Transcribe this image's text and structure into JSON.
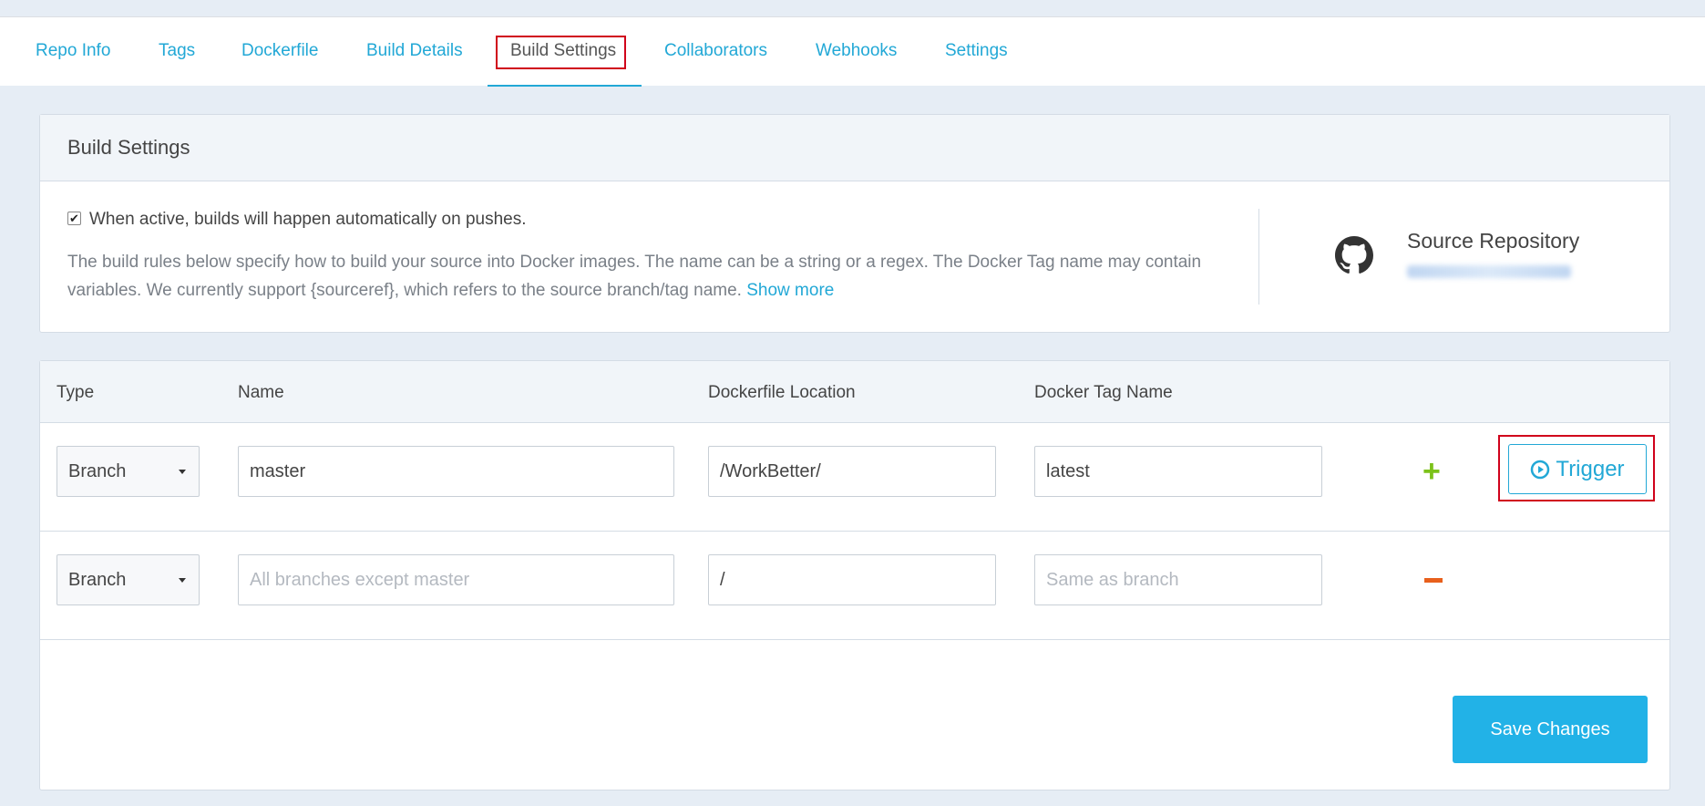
{
  "tabs": [
    {
      "label": "Repo Info"
    },
    {
      "label": "Tags"
    },
    {
      "label": "Dockerfile"
    },
    {
      "label": "Build Details"
    },
    {
      "label": "Build Settings",
      "active": true
    },
    {
      "label": "Collaborators"
    },
    {
      "label": "Webhooks"
    },
    {
      "label": "Settings"
    }
  ],
  "build_settings": {
    "title": "Build Settings",
    "autobuild_checked": true,
    "autobuild_label": "When active, builds will happen automatically on pushes.",
    "description": "The build rules below specify how to build your source into Docker images. The name can be a string or a regex. The Docker Tag name may contain variables. We currently support {sourceref}, which refers to the source branch/tag name.",
    "show_more": "Show more",
    "source_repository_label": "Source Repository",
    "source_icon": "github-icon"
  },
  "rules_table": {
    "headers": [
      "Type",
      "Name",
      "Dockerfile Location",
      "Docker Tag Name"
    ],
    "rows": [
      {
        "type": "Branch",
        "name": "master",
        "name_placeholder": "",
        "dockerfile": "/WorkBetter/",
        "tag": "latest",
        "tag_placeholder": "",
        "action_icon": "plus-icon",
        "trigger_label": "Trigger"
      },
      {
        "type": "Branch",
        "name": "",
        "name_placeholder": "All branches except master",
        "dockerfile": "/",
        "tag": "",
        "tag_placeholder": "Same as branch",
        "action_icon": "minus-icon"
      }
    ]
  },
  "save_label": "Save Changes",
  "colors": {
    "accent": "#22a8d6",
    "highlight": "#d0021b",
    "add": "#7cc21a",
    "remove": "#e8601c"
  }
}
